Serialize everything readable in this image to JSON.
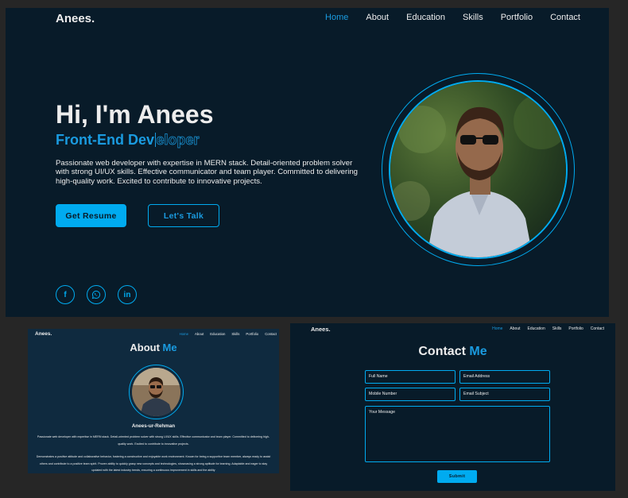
{
  "brand": "Anees.",
  "nav": [
    "Home",
    "About",
    "Education",
    "Skills",
    "Portfolio",
    "Contact"
  ],
  "nav_active": "Home",
  "hero": {
    "title": "Hi, I'm Anees",
    "subtitle_typed": "Front-End Dev",
    "subtitle_rest": "eloper",
    "description": "Passionate web developer with expertise in MERN stack. Detail-oriented problem solver with strong UI/UX skills. Effective communicator and team player. Committed to delivering high-quality work. Excited to contribute to innovative projects.",
    "buttons": {
      "resume": "Get Resume",
      "talk": "Let's Talk"
    },
    "social": [
      {
        "icon": "facebook-icon",
        "glyph": "f"
      },
      {
        "icon": "whatsapp-icon",
        "glyph": "✆"
      },
      {
        "icon": "linkedin-icon",
        "glyph": "in"
      }
    ]
  },
  "about": {
    "title": "About",
    "title_accent": "Me",
    "name": "Anees-ur-Rehman",
    "paragraph1": "Passionate web developer with expertise in MERN stack. Detail-oriented problem solver with strong UI/UX skills. Effective communicator and team player. Committed to delivering high-quality work. Excited to contribute to innovative projects.",
    "paragraph2": "Demonstrates a positive attitude and collaborative behavior, fostering a constructive and enjoyable work environment. Known for being a supportive team member, always ready to assist others and contribute to a positive team spirit. Proven ability to quickly grasp new concepts and technologies, showcasing a strong aptitude for learning. Adaptable and eager to stay updated with the latest industry trends, ensuring a continuous improvement in skills and the ability"
  },
  "contact": {
    "title": "Contact",
    "title_accent": "Me",
    "placeholders": {
      "full_name": "Full Name",
      "email": "Email Address",
      "mobile": "Mobile Number",
      "subject": "Email Subject",
      "message": "Your Message"
    },
    "submit": "Submit"
  },
  "colors": {
    "background": "#081b29",
    "accent": "#00abf0",
    "text": "#ededed"
  }
}
